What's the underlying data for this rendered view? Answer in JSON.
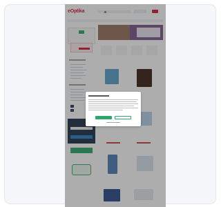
{
  "site": {
    "logo_text": "eOptika"
  },
  "colors": {
    "accent_green": "#2ea86a",
    "brand_red": "#d21f3c",
    "overlay": "rgba(40,40,40,0.38)"
  },
  "cookie_dialog": {
    "title": "",
    "accept_label": "",
    "settings_label": ""
  },
  "icons": [
    "cart-icon",
    "search-icon",
    "menu-icon"
  ]
}
